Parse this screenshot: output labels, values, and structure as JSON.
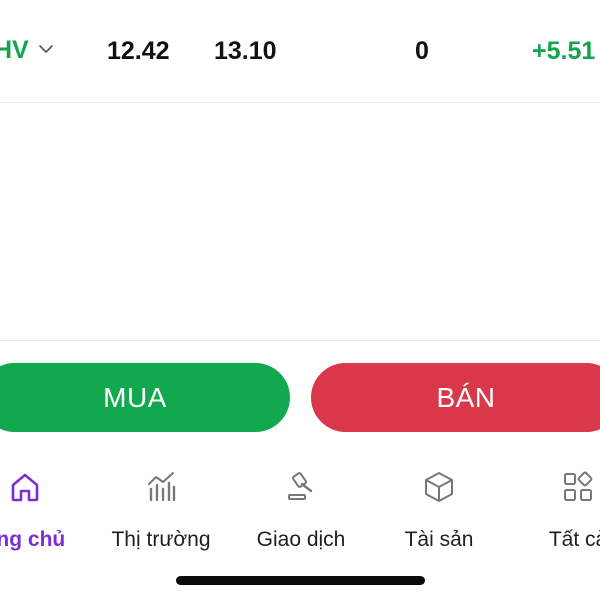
{
  "ticker": {
    "symbol": "HV",
    "values": [
      "12.42",
      "13.10",
      "0",
      "+5.51"
    ]
  },
  "actions": {
    "buy_label": "MUA",
    "sell_label": "BÁN",
    "buy_color": "#12a84e",
    "sell_color": "#d9374a"
  },
  "nav": {
    "active_color": "#7a2fd6",
    "items": [
      {
        "label": "ang chủ",
        "icon": "home-icon"
      },
      {
        "label": "Thị trường",
        "icon": "market-chart-icon"
      },
      {
        "label": "Giao dịch",
        "icon": "gavel-icon"
      },
      {
        "label": "Tài sản",
        "icon": "cube-icon"
      },
      {
        "label": "Tất cả",
        "icon": "grid-icon"
      }
    ]
  }
}
